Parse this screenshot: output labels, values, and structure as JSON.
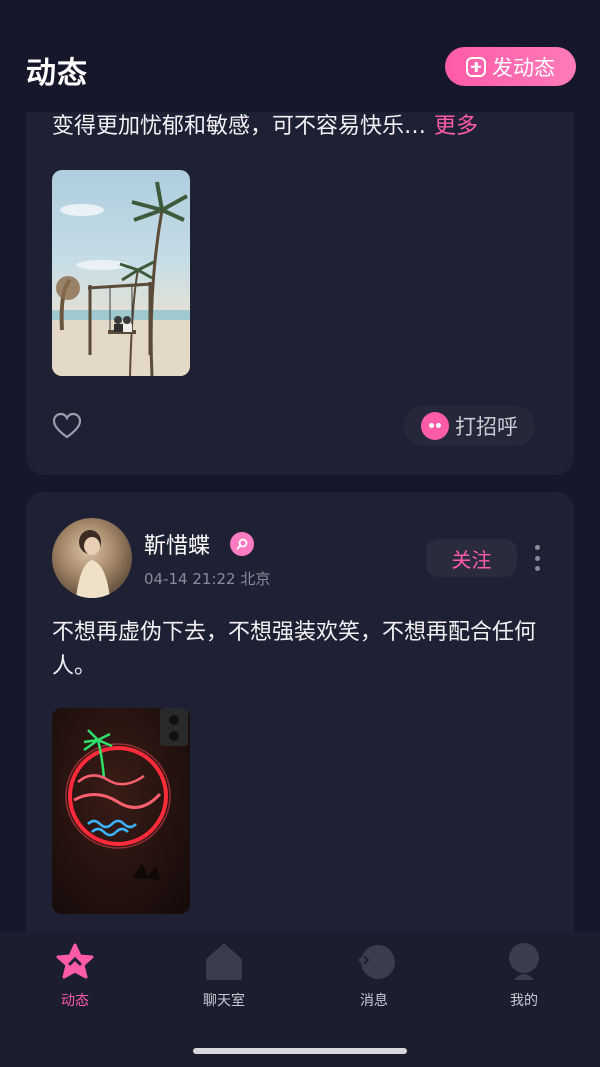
{
  "header": {
    "title": "动态",
    "post_button_label": "发动态"
  },
  "feed": {
    "posts": [
      {
        "text": "变得更加忧郁和敏感，可不容易快乐…",
        "more_label": "更多",
        "image": "beach-swing-photo",
        "greet_label": "打招呼"
      },
      {
        "username": "靳惜蝶",
        "date": "04-14 21:22",
        "location": "北京",
        "follow_label": "关注",
        "text": "不想再虚伪下去，不想强装欢笑，不想再配合任何人。",
        "image": "neon-paradise-sign-photo"
      }
    ]
  },
  "tabbar": {
    "items": [
      {
        "label": "动态",
        "icon": "star-icon",
        "active": true
      },
      {
        "label": "聊天室",
        "icon": "house-icon",
        "active": false
      },
      {
        "label": "消息",
        "icon": "chat-bubble-icon",
        "active": false
      },
      {
        "label": "我的",
        "icon": "person-icon",
        "active": false
      }
    ]
  },
  "colors": {
    "accent": "#ff5ba7",
    "background": "#16172a",
    "card": "#1e2033"
  }
}
